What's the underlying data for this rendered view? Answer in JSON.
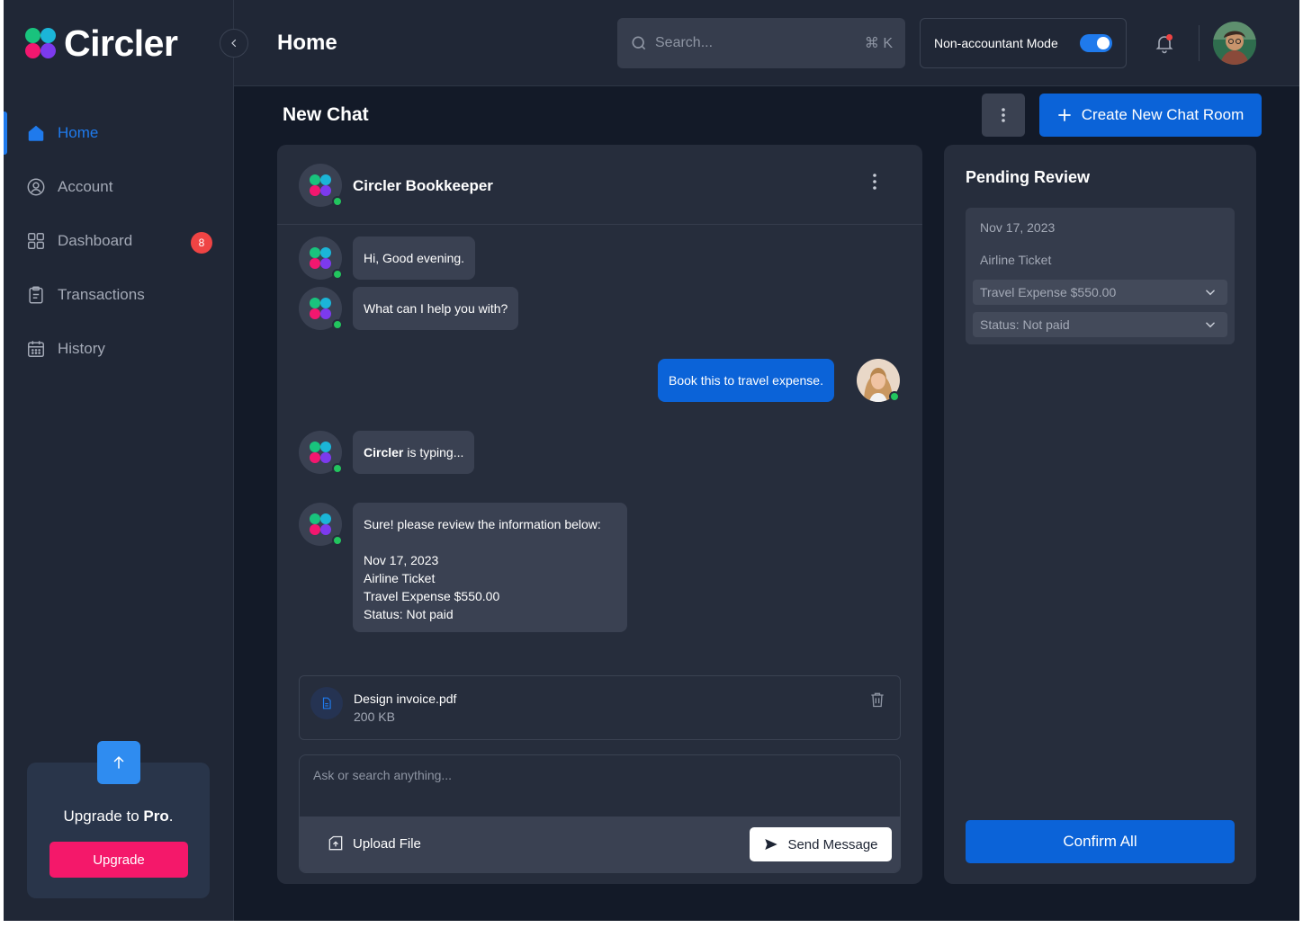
{
  "brand": {
    "name": "Circler",
    "colors": {
      "green": "#19c37d",
      "teal": "#1bb5d8",
      "pink": "#f2176f",
      "purple": "#7c3aed",
      "accent": "#1f7aec",
      "upgrade": "#f4186a",
      "online": "#22c55e"
    }
  },
  "sidebar": {
    "items": [
      {
        "label": "Home",
        "icon": "home-icon",
        "active": true
      },
      {
        "label": "Account",
        "icon": "account-icon"
      },
      {
        "label": "Dashboard",
        "icon": "dashboard-icon"
      },
      {
        "label": "Transactions",
        "icon": "transactions-icon"
      },
      {
        "label": "History",
        "icon": "calendar-icon",
        "badge": "8"
      }
    ],
    "upgrade": {
      "text_prefix": "Upgrade to",
      "text_bold": "Pro",
      "text_suffix": ".",
      "button": "Upgrade"
    }
  },
  "header": {
    "title": "Home",
    "search": {
      "placeholder": "Search...",
      "shortcut": "⌘ K"
    },
    "mode": {
      "label": "Non-accountant Mode",
      "enabled": true
    }
  },
  "content": {
    "title": "New Chat",
    "create_button": "Create New Chat Room"
  },
  "chat": {
    "name": "Circler Bookkeeper",
    "messages": [
      {
        "from": "bot",
        "text": "Hi, Good evening."
      },
      {
        "from": "bot",
        "text": "What can I help you with?"
      },
      {
        "from": "user",
        "text": "Book this to travel expense."
      },
      {
        "from": "bot",
        "typing_name": "Circler",
        "typing_text": "is typing..."
      },
      {
        "from": "bot",
        "lines": [
          "Sure! please review the information below:",
          "Nov 17, 2023",
          "Airline Ticket",
          "Travel Expense $550.00",
          "Status: Not paid"
        ]
      }
    ],
    "attachment": {
      "name": "Design invoice.pdf",
      "size": "200 KB"
    },
    "composer": {
      "placeholder": "Ask or search anything...",
      "upload": "Upload File",
      "send": "Send Message"
    }
  },
  "review": {
    "title": "Pending Review",
    "date": "Nov 17, 2023",
    "item": "Airline Ticket",
    "category": "Travel Expense $550.00",
    "status": "Status: Not paid",
    "confirm": "Confirm All"
  }
}
